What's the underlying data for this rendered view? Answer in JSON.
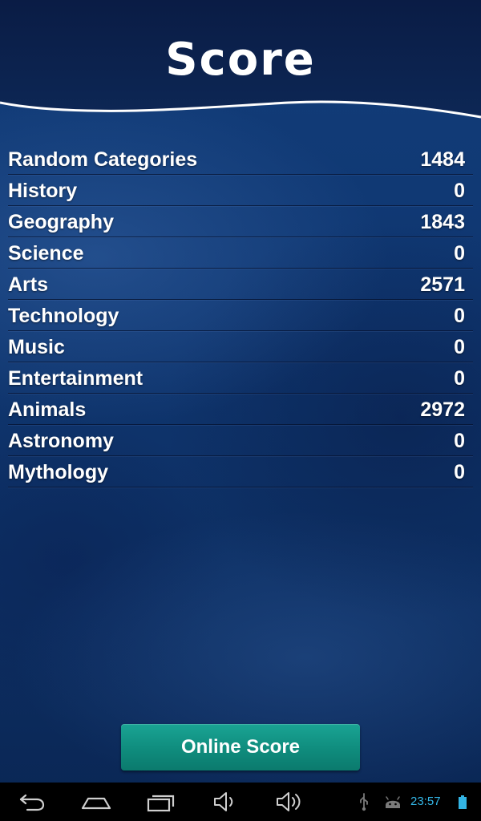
{
  "header": {
    "title": "Score"
  },
  "scores": [
    {
      "category": "Random Categories",
      "value": "1484"
    },
    {
      "category": "History",
      "value": "0"
    },
    {
      "category": "Geography",
      "value": "1843"
    },
    {
      "category": "Science",
      "value": "0"
    },
    {
      "category": "Arts",
      "value": "2571"
    },
    {
      "category": "Technology",
      "value": "0"
    },
    {
      "category": "Music",
      "value": "0"
    },
    {
      "category": "Entertainment",
      "value": "0"
    },
    {
      "category": "Animals",
      "value": "2972"
    },
    {
      "category": "Astronomy",
      "value": "0"
    },
    {
      "category": "Mythology",
      "value": "0"
    }
  ],
  "online_button": {
    "label": "Online Score"
  },
  "status_bar": {
    "time": "23:57",
    "icons": [
      "back-icon",
      "home-icon",
      "recent-apps-icon",
      "volume-down-icon",
      "volume-up-icon",
      "usb-icon",
      "android-icon",
      "battery-icon"
    ]
  },
  "colors": {
    "header_bg": "#0b1f4a",
    "background": "#0f3670",
    "button": "#0f8c7d",
    "clock": "#33b5e5"
  }
}
